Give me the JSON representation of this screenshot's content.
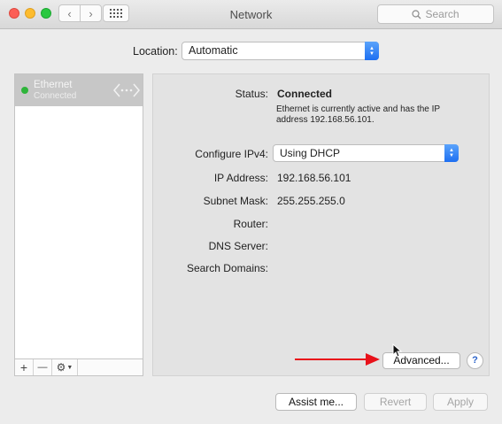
{
  "window": {
    "title": "Network"
  },
  "toolbar": {
    "search_placeholder": "Search"
  },
  "location": {
    "label": "Location:",
    "value": "Automatic"
  },
  "services": [
    {
      "name": "Ethernet",
      "status": "Connected"
    }
  ],
  "sidebar_buttons": {
    "add": "+",
    "remove": "—",
    "action": "⚙"
  },
  "details": {
    "status_label": "Status:",
    "status_value": "Connected",
    "status_description": "Ethernet is currently active and has the IP address 192.168.56.101.",
    "configure_label": "Configure IPv4:",
    "configure_value": "Using DHCP",
    "ip_label": "IP Address:",
    "ip_value": "192.168.56.101",
    "subnet_label": "Subnet Mask:",
    "subnet_value": "255.255.255.0",
    "router_label": "Router:",
    "dns_label": "DNS Server:",
    "search_domains_label": "Search Domains:"
  },
  "buttons": {
    "advanced": "Advanced...",
    "help": "?",
    "assist": "Assist me...",
    "revert": "Revert",
    "apply": "Apply"
  },
  "colors": {
    "accent": "#1d6ff1",
    "status_green": "#2eb43a",
    "annotation_arrow": "#e8111a"
  }
}
